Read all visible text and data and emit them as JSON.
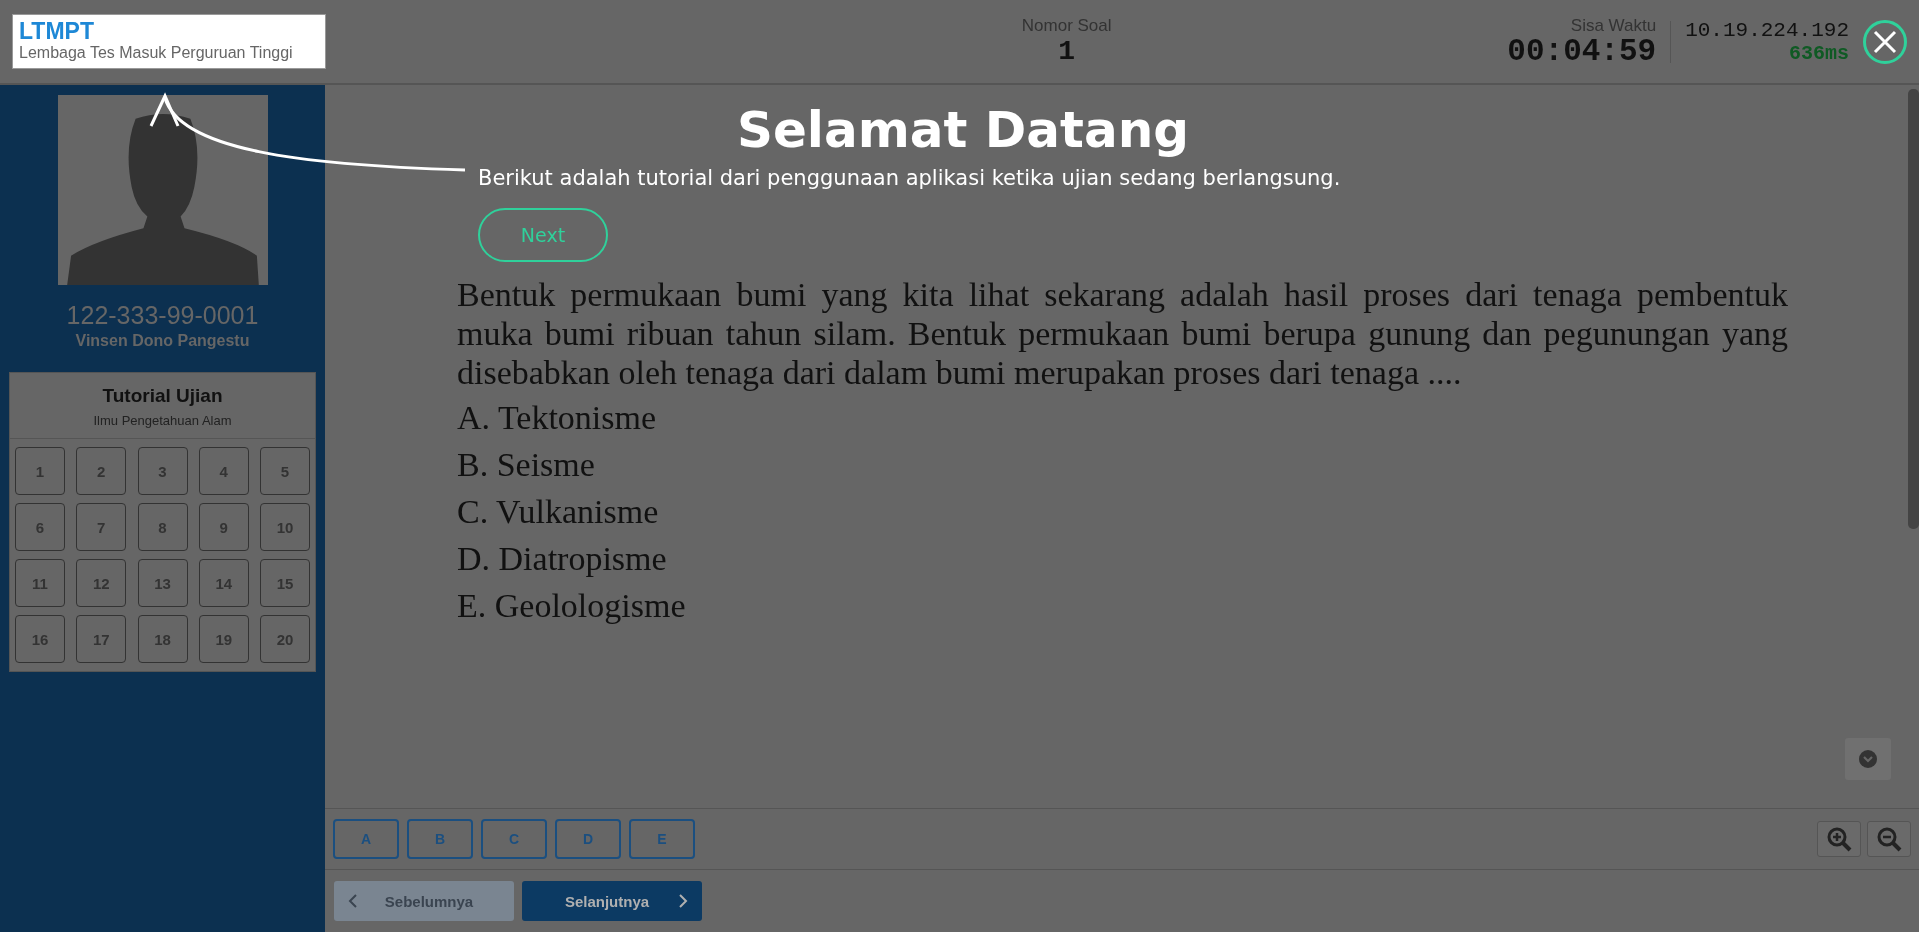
{
  "header": {
    "logo_title": "LTMPT",
    "logo_subtitle": "Lembaga Tes Masuk Perguruan Tinggi",
    "question_number_label": "Nomor Soal",
    "question_number": "1",
    "timer_label": "Sisa Waktu",
    "timer": "00:04:59",
    "server_ip": "10.19.224.192",
    "latency": "636ms"
  },
  "sidebar": {
    "participant_id": "122-333-99-0001",
    "participant_name": "Vinsen Dono Pangestu",
    "panel_title": "Tutorial Ujian",
    "panel_subtitle": "Ilmu Pengetahuan Alam",
    "questions": [
      "1",
      "2",
      "3",
      "4",
      "5",
      "6",
      "7",
      "8",
      "9",
      "10",
      "11",
      "12",
      "13",
      "14",
      "15",
      "16",
      "17",
      "18",
      "19",
      "20"
    ]
  },
  "question": {
    "text": "Bentuk permukaan bumi yang kita lihat sekarang adalah hasil proses dari tenaga pembentuk muka bumi ribuan tahun silam. Bentuk permukaan bumi berupa gunung dan pegunungan yang disebabkan oleh tenaga dari dalam bumi merupakan proses dari tenaga ....",
    "options": [
      "A. Tektonisme",
      "B. Seisme",
      "C. Vulkanisme",
      "D. Diatropisme",
      "E. Geolologisme"
    ]
  },
  "answer_buttons": [
    "A",
    "B",
    "C",
    "D",
    "E"
  ],
  "navigation": [
    {
      "label": "Sebelumnya",
      "kind": "prev",
      "disabled": true
    },
    {
      "label": "Selanjutnya",
      "kind": "next",
      "disabled": false
    }
  ],
  "tutorial": {
    "title": "Selamat Datang",
    "text": "Berikut adalah tutorial dari penggunaan aplikasi ketika ujian sedang berlangsung.",
    "next_label": "Next"
  }
}
